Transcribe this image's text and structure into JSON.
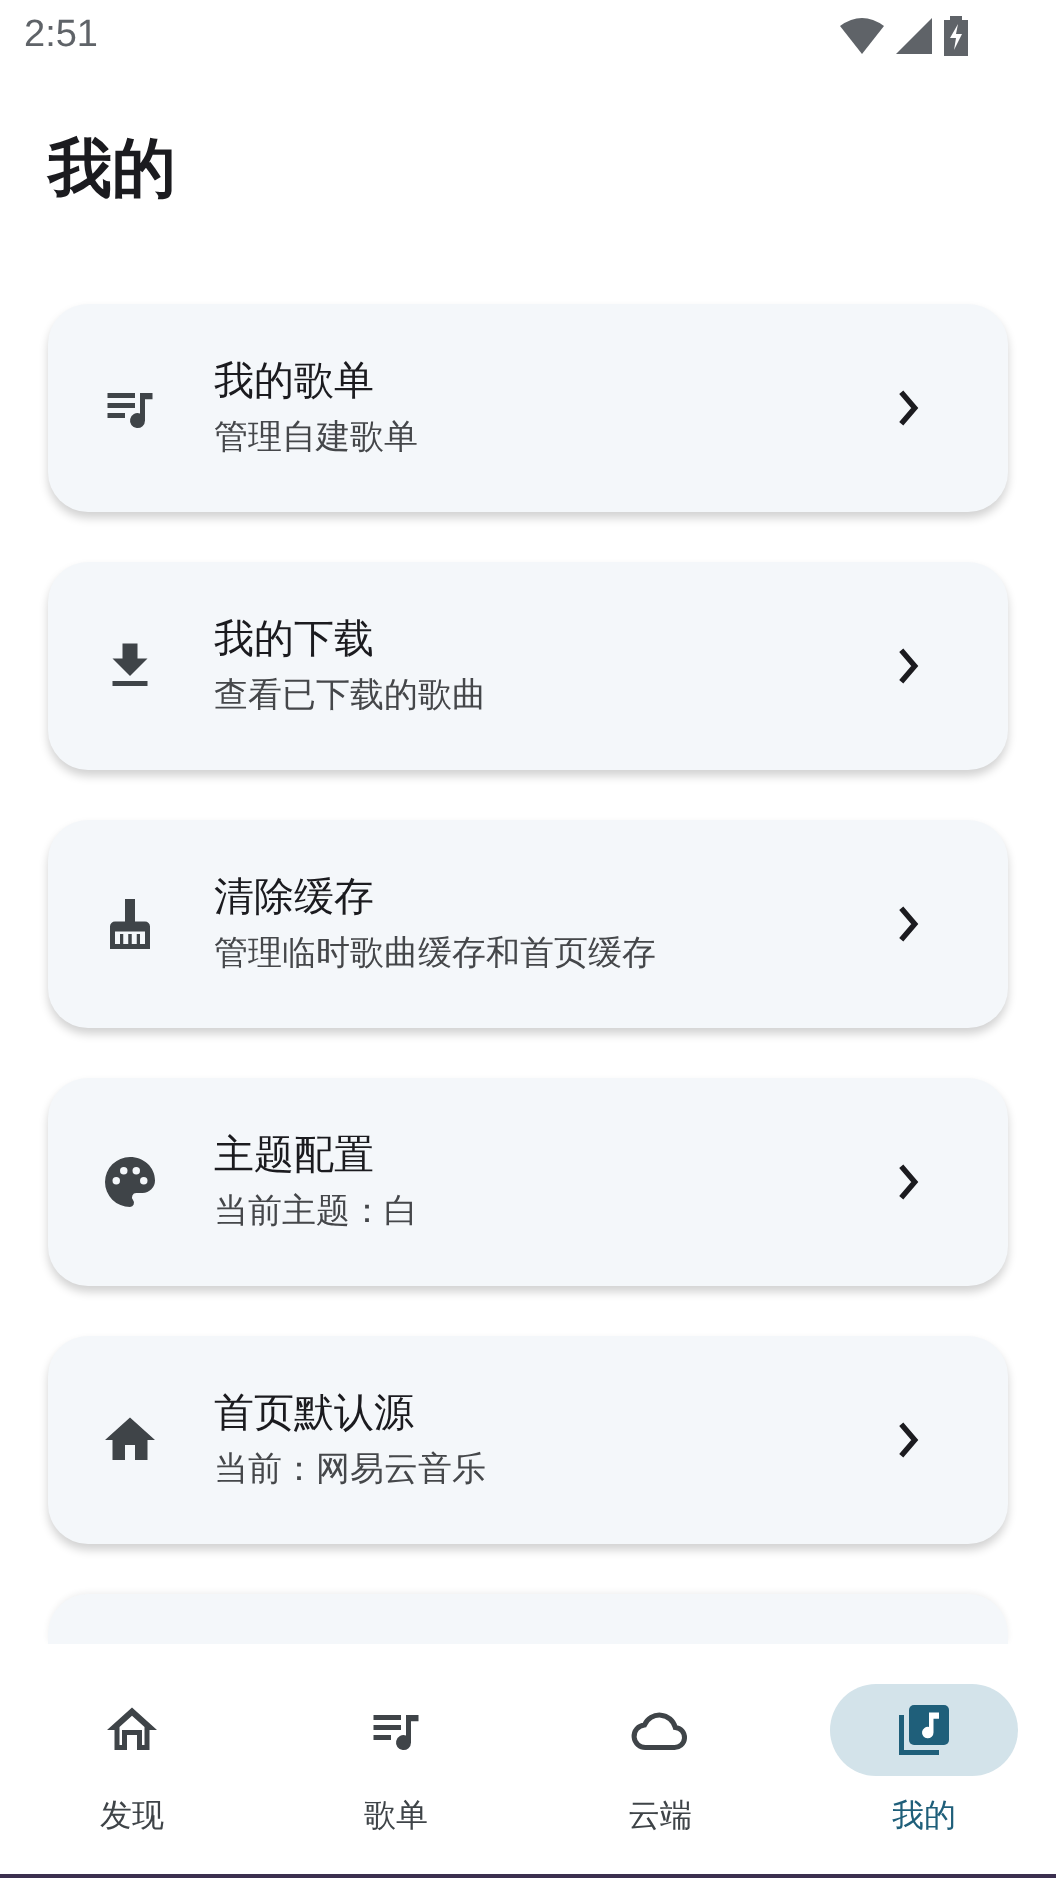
{
  "status_bar": {
    "time": "2:51"
  },
  "title": "我的",
  "items": [
    {
      "kind": "playlist",
      "title": "我的歌单",
      "subtitle": "管理自建歌单"
    },
    {
      "kind": "download",
      "title": "我的下载",
      "subtitle": "查看已下载的歌曲"
    },
    {
      "kind": "broom",
      "title": "清除缓存",
      "subtitle": "管理临时歌曲缓存和首页缓存"
    },
    {
      "kind": "palette",
      "title": "主题配置",
      "subtitle": "当前主题：白"
    },
    {
      "kind": "home",
      "title": "首页默认源",
      "subtitle": "当前：网易云音乐"
    }
  ],
  "nav": [
    {
      "kind": "home",
      "label": "发现",
      "selected": false
    },
    {
      "kind": "playlist",
      "label": "歌单",
      "selected": false
    },
    {
      "kind": "cloud",
      "label": "云端",
      "selected": false
    },
    {
      "kind": "library",
      "label": "我的",
      "selected": true
    }
  ]
}
